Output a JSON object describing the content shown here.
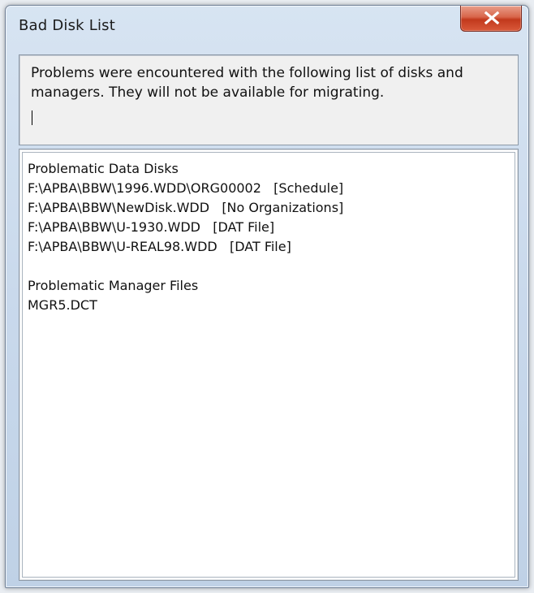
{
  "window": {
    "title": "Bad Disk List",
    "close_symbol": "X"
  },
  "message": {
    "text": "Problems were encountered with the following list of disks and managers. They will not be available for migrating."
  },
  "list": {
    "data_disks_heading": "Problematic Data Disks",
    "data_disks": [
      "F:\\APBA\\BBW\\1996.WDD\\ORG00002   [Schedule]",
      "F:\\APBA\\BBW\\NewDisk.WDD   [No Organizations]",
      "F:\\APBA\\BBW\\U-1930.WDD   [DAT File]",
      "F:\\APBA\\BBW\\U-REAL98.WDD   [DAT File]"
    ],
    "manager_files_heading": "Problematic Manager Files",
    "manager_files": [
      "MGR5.DCT"
    ]
  },
  "icons": {
    "close": "close-icon"
  },
  "colors": {
    "close_button": "#c94a2e",
    "title_bar": "#cbdaeb",
    "panel_background": "#f0f0f0",
    "list_background": "#ffffff"
  }
}
